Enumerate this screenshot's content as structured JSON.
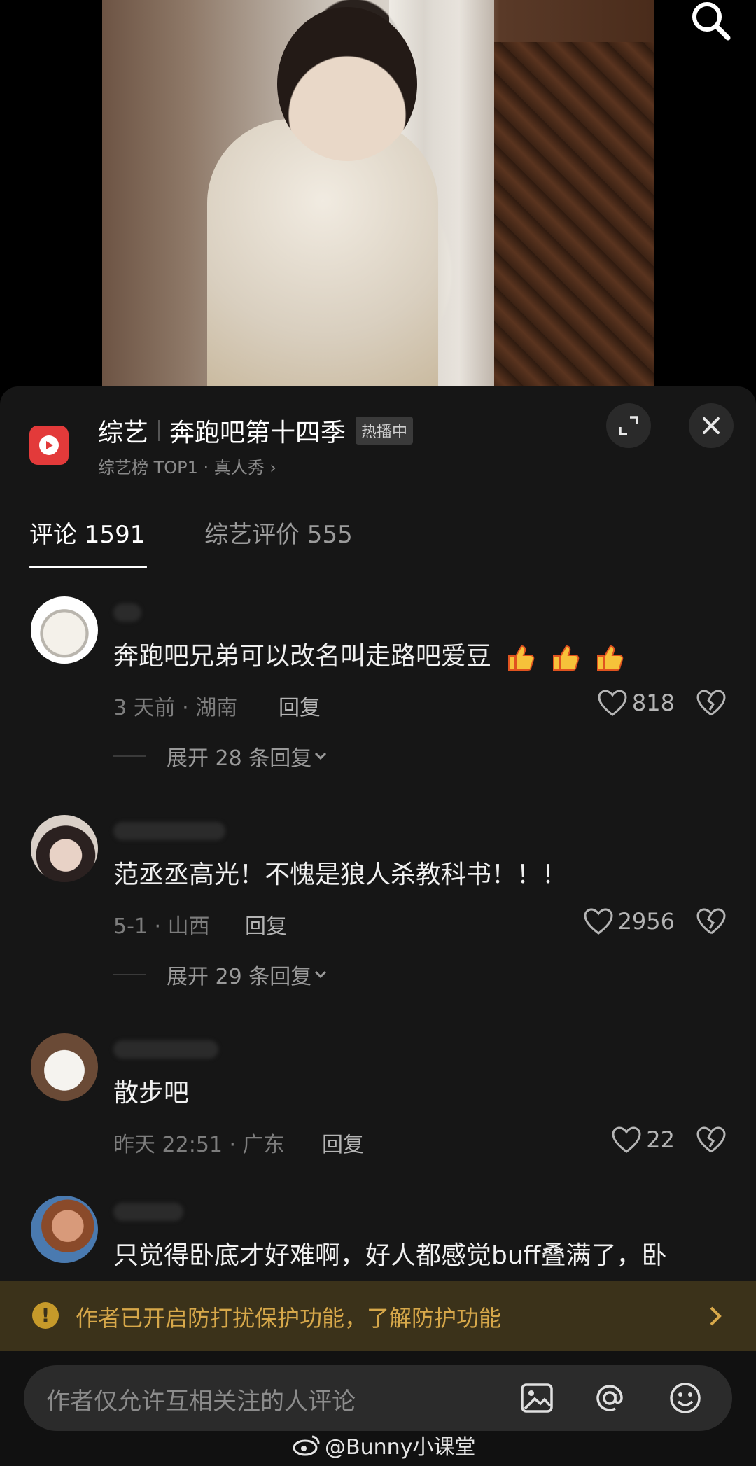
{
  "show": {
    "category": "综艺",
    "title": "奔跑吧第十四季",
    "badge": "热播中",
    "subtitle": "综艺榜 TOP1 · 真人秀 ›"
  },
  "tabs": [
    {
      "label": "评论 1591"
    },
    {
      "label": "综艺评价 555"
    }
  ],
  "comments": [
    {
      "text": "奔跑吧兄弟可以改名叫走路吧爱豆",
      "emoji": "thumbs-up ×3",
      "meta": "3 天前 · 湖南",
      "reply": "回复",
      "likes": "818",
      "expand": "展开 28 条回复"
    },
    {
      "text": "范丞丞高光！不愧是狼人杀教科书！！！",
      "meta": "5-1 · 山西",
      "reply": "回复",
      "likes": "2956",
      "expand": "展开 29 条回复"
    },
    {
      "text": "散步吧",
      "meta": "昨天 22:51 · 广东",
      "reply": "回复",
      "likes": "22"
    },
    {
      "text": "只觉得卧底才好难啊，好人都感觉buff叠满了，卧"
    }
  ],
  "notice": {
    "text": "作者已开启防打扰保护功能，了解防护功能"
  },
  "input": {
    "placeholder": "作者仅允许互相关注的人评论"
  },
  "watermark": "@Bunny小课堂",
  "colors": {
    "panel": "#161616",
    "notice_bg": "#3b321a",
    "notice_text": "#d7a84a",
    "logo": "#e33a3a"
  },
  "icons": [
    "search-icon",
    "expand-icon",
    "close-icon",
    "heart-icon",
    "broken-heart-icon",
    "chevron-down-icon",
    "warning-icon",
    "chevron-right-icon",
    "image-icon",
    "at-icon",
    "emoji-icon",
    "weibo-icon"
  ]
}
